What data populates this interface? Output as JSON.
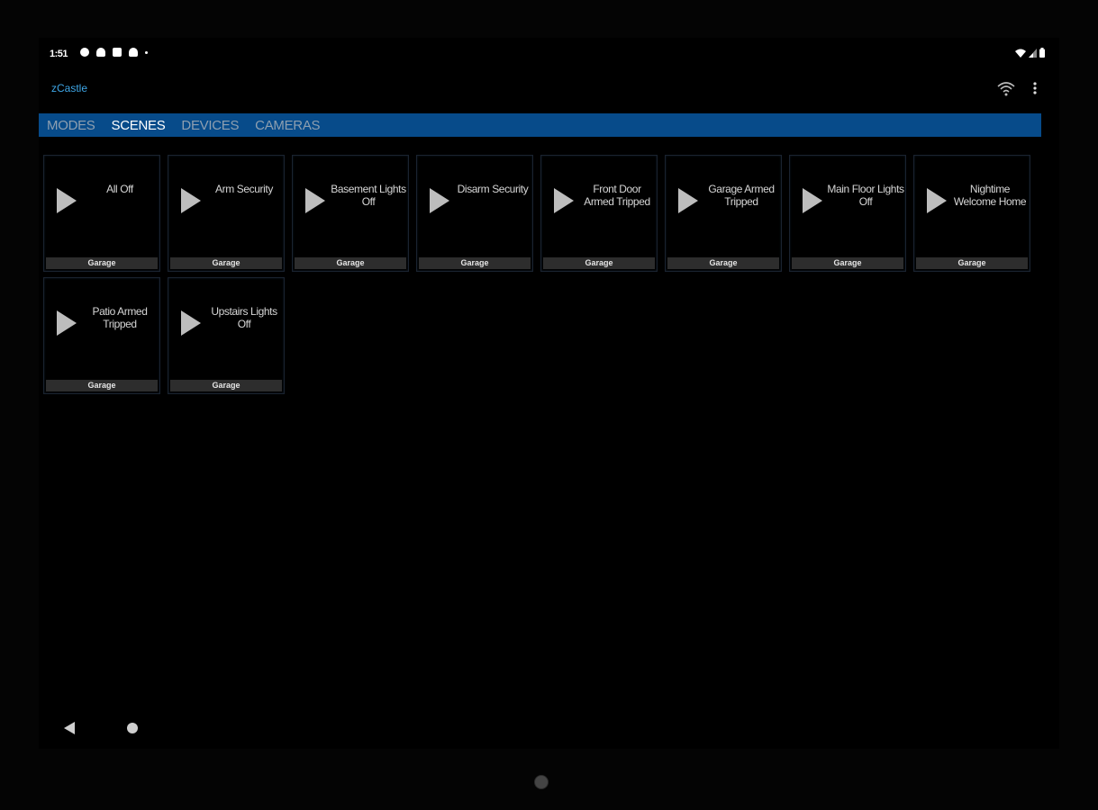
{
  "status_bar": {
    "time": "1:51",
    "left_icons": [
      "settings-status-icon",
      "heart-status-icon",
      "square-status-icon",
      "heart-status-icon-2",
      "dot-status-icon"
    ],
    "right_icons": [
      "wifi-status-icon",
      "signal-status-icon",
      "battery-status-icon"
    ]
  },
  "app_bar": {
    "title": "zCastle",
    "actions": [
      "wifi-icon",
      "overflow-menu-icon"
    ]
  },
  "tabs": [
    {
      "label": "MODES",
      "active": false
    },
    {
      "label": "SCENES",
      "active": true
    },
    {
      "label": "DEVICES",
      "active": false
    },
    {
      "label": "CAMERAS",
      "active": false
    }
  ],
  "scenes": [
    {
      "label": "All Off",
      "room": "Garage"
    },
    {
      "label": "Arm Security",
      "room": "Garage"
    },
    {
      "label": "Basement Lights Off",
      "room": "Garage"
    },
    {
      "label": "Disarm Security",
      "room": "Garage"
    },
    {
      "label": "Front Door Armed Tripped",
      "room": "Garage"
    },
    {
      "label": "Garage Armed Tripped",
      "room": "Garage"
    },
    {
      "label": "Main Floor Lights Off",
      "room": "Garage"
    },
    {
      "label": "Nightime Welcome Home",
      "room": "Garage"
    },
    {
      "label": "Patio Armed Tripped",
      "room": "Garage"
    },
    {
      "label": "Upstairs Lights Off",
      "room": "Garage"
    }
  ],
  "colors": {
    "tab_bar": "#074b8a",
    "app_title": "#3ea6e6",
    "tile_room_bg": "#2d2d2d",
    "play_icon": "#bdbdbd"
  }
}
